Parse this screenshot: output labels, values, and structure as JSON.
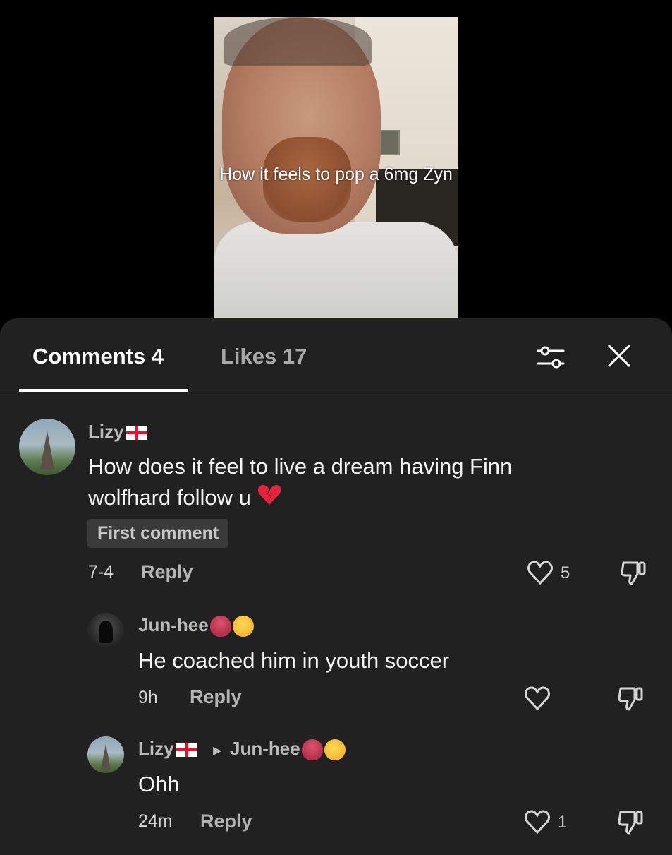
{
  "video": {
    "caption": "How it feels to pop a 6mg Zyn"
  },
  "tabs": [
    {
      "label": "Comments 4",
      "active": true
    },
    {
      "label": "Likes 17",
      "active": false
    }
  ],
  "toolbar": {
    "filter_icon": "sliders-icon",
    "close_icon": "close-icon"
  },
  "comments": [
    {
      "user": "Lizy",
      "body": "How does it feel to live a dream having Finn wolfhard follow u",
      "badge": "First comment",
      "time": "7-4",
      "reply_label": "Reply",
      "likes": "5"
    },
    {
      "user": "Jun-hee",
      "body": "He coached him in youth soccer",
      "time": "9h",
      "reply_label": "Reply",
      "likes": ""
    },
    {
      "user": "Lizy",
      "reply_to": "Jun-hee",
      "body": "Ohh",
      "time": "24m",
      "reply_label": "Reply",
      "likes": "1"
    }
  ],
  "colors": {
    "sheet": "#212121",
    "accent_heart": "#e5223b"
  }
}
